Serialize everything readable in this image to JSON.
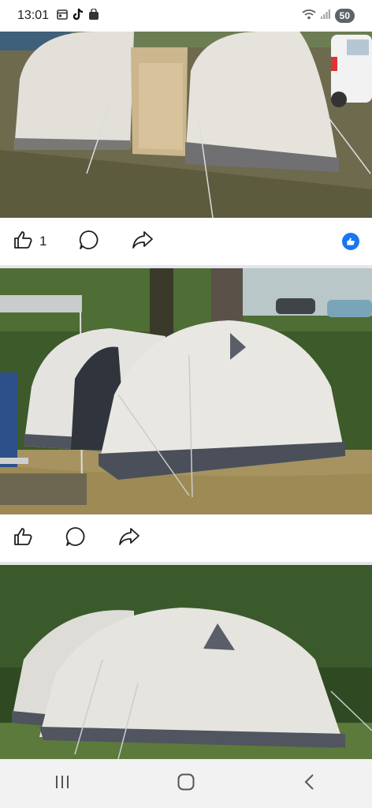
{
  "status_bar": {
    "time": "13:01",
    "battery": "50",
    "left_icons": [
      "calendar-icon",
      "tiktok-icon",
      "shopping-bag-icon"
    ],
    "right_icons": [
      "wifi-icon",
      "signal-icon"
    ]
  },
  "posts": [
    {
      "image_alt": "tent-image",
      "like_count": "1",
      "has_reaction_badge": true
    },
    {
      "image_alt": "tent-image",
      "like_count": "",
      "has_reaction_badge": false
    },
    {
      "image_alt": "tent-image"
    }
  ],
  "actions": [
    "like-icon",
    "comment-icon",
    "share-icon"
  ],
  "nav": [
    "recent-apps-icon",
    "home-icon",
    "back-icon"
  ]
}
